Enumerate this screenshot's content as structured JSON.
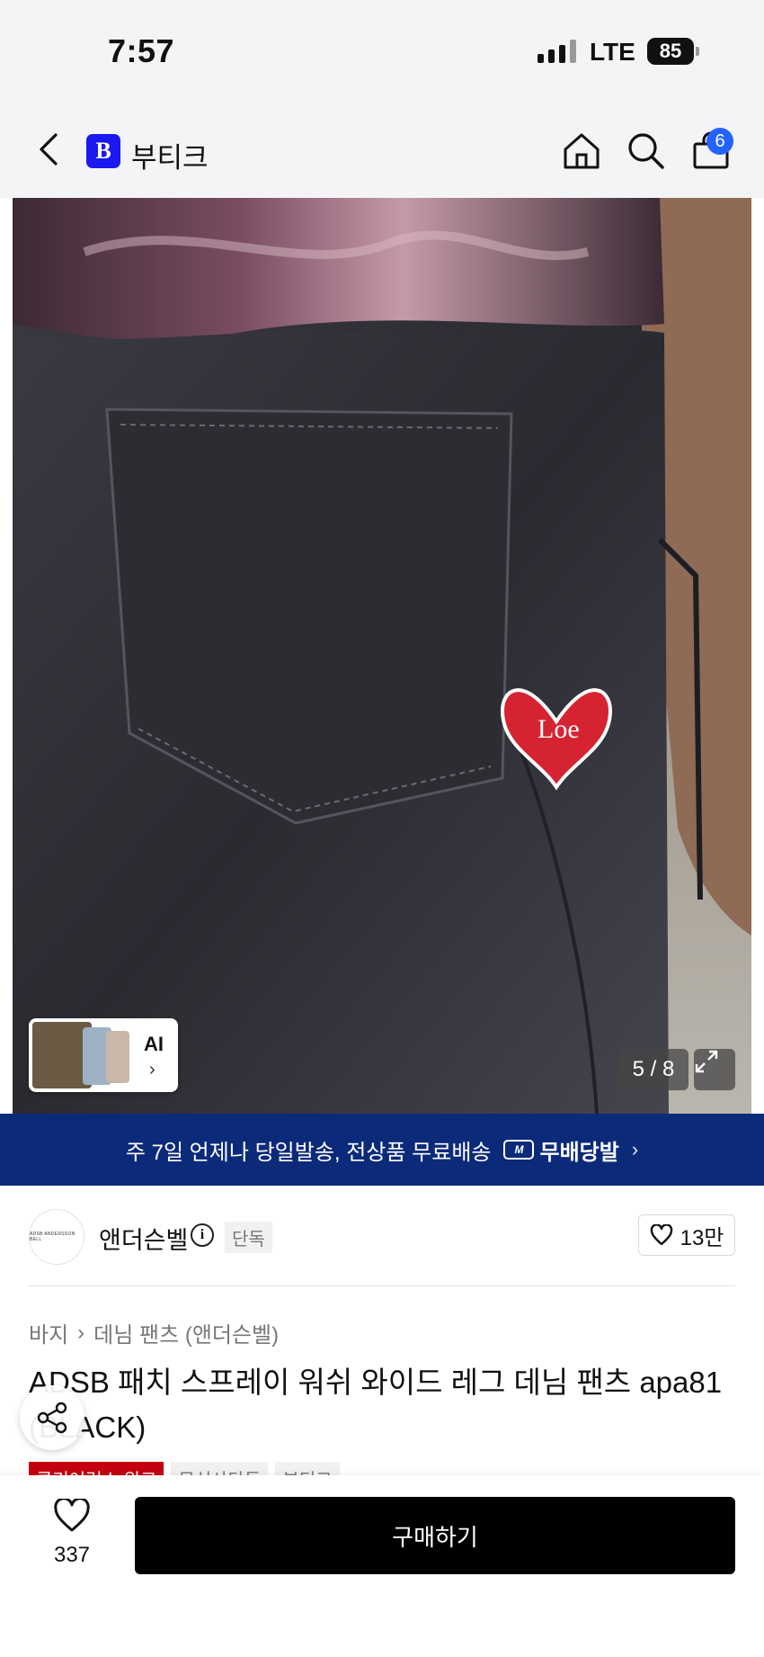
{
  "status": {
    "time": "7:57",
    "network": "LTE",
    "battery": "85"
  },
  "appbar": {
    "logo_letter": "B",
    "title": "부티크",
    "cart_count": "6",
    "icons": {
      "back": "chevron-left-icon",
      "home": "home-icon",
      "search": "search-icon",
      "cart": "shopping-bag-icon"
    }
  },
  "gallery": {
    "ai_label": "AI",
    "ai_arrow": "›",
    "counter": "5 / 8",
    "patch_text": "Loe"
  },
  "banner": {
    "text": "주 7일 언제나 당일발송, 전상품 무료배송",
    "badge": "무배당발",
    "badge_icon": "M",
    "chevron": "›",
    "color": "#0c2a7a"
  },
  "brand": {
    "logo_text": "ADSB ANDERSSON BELL",
    "name": "앤더슨벨",
    "info": "i",
    "exclusive": "단독",
    "likes": "13만"
  },
  "product": {
    "breadcrumb": [
      "바지",
      "데님 팬츠 (앤더슨벨)"
    ],
    "breadcrumb_sep": "›",
    "title": "ADSB 패치 스프레이 워쉬 와이드 레그 데님 팬츠 apa81 (BLACK)",
    "tags": [
      "클리어런스 위크",
      "무신사단독",
      "부티크"
    ]
  },
  "bottom": {
    "wish_count": "337",
    "buy_label": "구매하기"
  },
  "colors": {
    "accent_blue": "#2563ff",
    "brand_blue": "#1919f0",
    "tag_red": "#c40010"
  }
}
